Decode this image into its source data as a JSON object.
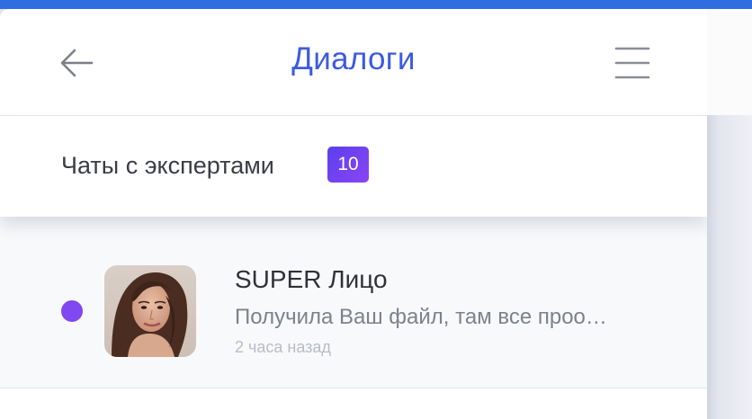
{
  "header": {
    "back_icon": "arrow-left-icon",
    "title": "Диалоги",
    "menu_icon": "hamburger-menu-icon",
    "title_color": "#3c5ae0"
  },
  "tabs": {
    "experts_label": "Чаты с экспертами",
    "experts_count": "10",
    "badge_color": "#6b42f0"
  },
  "chats": [
    {
      "name": "SUPER Лицо",
      "preview": "Получила Ваш файл, там все проо…",
      "time": "2 часа назад",
      "unread": true,
      "unread_color": "#8048ef"
    }
  ]
}
